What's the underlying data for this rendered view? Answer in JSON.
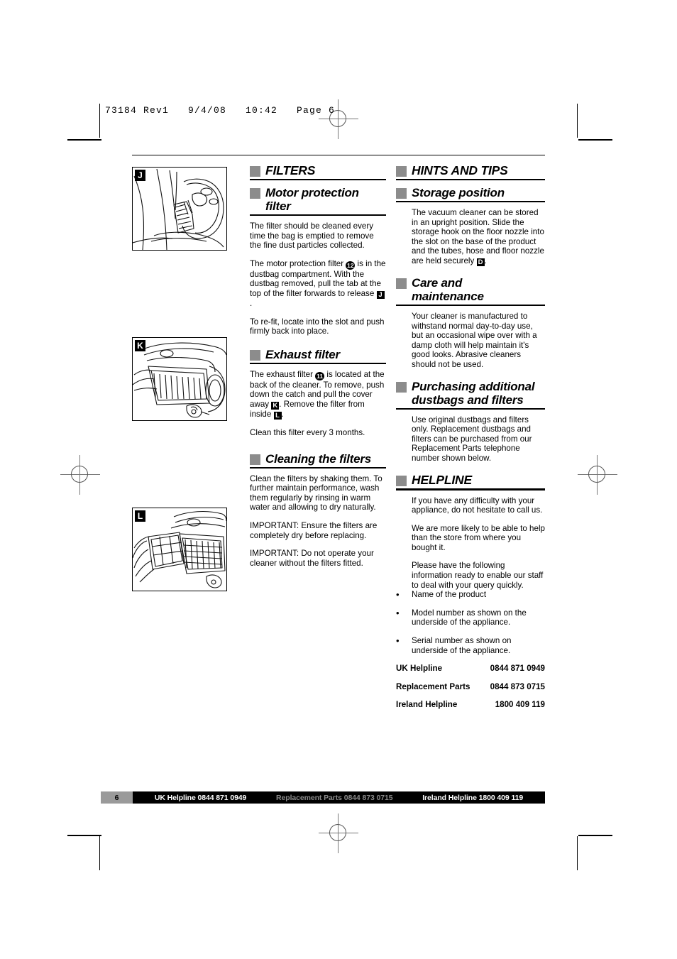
{
  "prepress": {
    "header_line": "73184 Rev1   9/4/08   10:42   Page 6"
  },
  "left_column": {
    "figures": [
      {
        "label": "J",
        "name": "motor-protection-filter-diagram"
      },
      {
        "label": "K",
        "name": "exhaust-filter-cover-diagram"
      },
      {
        "label": "L",
        "name": "exhaust-filter-removal-diagram"
      }
    ],
    "sections": [
      {
        "heading": "FILTERS",
        "paragraphs": []
      },
      {
        "heading": "Motor protection filter",
        "paragraphs": [
          "The filter should be cleaned every time the bag is emptied to remove the fine dust particles collected.",
          "The motor protection filter [12] is in the dustbag compartment. With the dustbag removed, pull the tab at the top of the filter forwards to release [J].",
          "To re-fit, locate into the slot and push firmly back into place."
        ]
      },
      {
        "heading": "Exhaust filter",
        "paragraphs": [
          "The exhaust filter [11] is located at the back of the cleaner. To remove, push down the catch and pull the cover away [K]. Remove the filter from inside [L].",
          "Clean this filter every 3 months."
        ]
      },
      {
        "heading": "Cleaning the filters",
        "paragraphs": [
          "Clean the filters by shaking them. To further maintain performance, wash them regularly by rinsing in warm water and allowing to dry naturally.",
          "IMPORTANT: Ensure the filters are completely dry before replacing.",
          "IMPORTANT: Do not operate your cleaner without the filters fitted."
        ]
      }
    ],
    "text": {
      "motor_p1": "The filter should be cleaned every time the bag is emptied to remove the fine dust particles collected.",
      "motor_p2_a": "The motor protection filter ",
      "motor_p2_badge1": "12",
      "motor_p2_b": " is in the dustbag compartment. With the dustbag removed, pull the tab at the top of the filter forwards to release ",
      "motor_p2_badge2": "J",
      "motor_p2_c": ".",
      "motor_p3": "To re-fit, locate into the slot and push firmly back into place.",
      "exhaust_p1_a": "The exhaust filter ",
      "exhaust_p1_badge1": "11",
      "exhaust_p1_b": " is located at the back of the cleaner. To remove, push down the catch and pull the cover away ",
      "exhaust_p1_badge2": "K",
      "exhaust_p1_c": ". Remove the filter from inside ",
      "exhaust_p1_badge3": "L",
      "exhaust_p1_d": ".",
      "exhaust_p2": "Clean this filter every 3 months.",
      "clean_p1": "Clean the filters by shaking them. To further maintain performance, wash them regularly by rinsing in warm water and allowing to dry naturally.",
      "clean_p2": "IMPORTANT: Ensure the filters are completely dry before replacing.",
      "clean_p3": "IMPORTANT: Do not operate your cleaner without the filters fitted."
    },
    "headings": {
      "filters": "FILTERS",
      "motor_protection_filter": "Motor protection filter",
      "exhaust_filter": "Exhaust filter",
      "cleaning_the_filters": "Cleaning the filters"
    }
  },
  "right_column": {
    "headings": {
      "hints_and_tips": "HINTS AND TIPS",
      "storage_position": "Storage position",
      "care_line1": "Care and",
      "care_line2": "maintenance",
      "purchasing_line1": "Purchasing additional",
      "purchasing_line2": "dustbags and filters",
      "helpline": "HELPLINE"
    },
    "text": {
      "storage_a": "The vacuum cleaner can be stored in an upright position. Slide the storage hook on the floor nozzle into the slot on the base of the product and the tubes, hose and floor nozzle are held securely ",
      "storage_badge": "D",
      "storage_b": ".",
      "care_p1": "Your cleaner is manufactured to withstand normal day-to-day use, but an occasional wipe over with a damp cloth will help maintain it's good looks. Abrasive cleaners should not be used.",
      "purchasing_p1": "Use original dustbags and filters only. Replacement dustbags and filters can be purchased from our Replacement Parts telephone number shown below.",
      "helpline_p1": "If you have any difficulty with your appliance, do not hesitate to call us.",
      "helpline_p2": "We are more likely to be able to help than the store from where you bought it.",
      "helpline_p3": "Please have the following information ready to enable our staff to deal with your query quickly."
    },
    "bullets": [
      "Name of the product",
      "Model number as shown on the underside of the appliance.",
      "Serial number as shown on underside of the appliance."
    ],
    "bullet_glyph": "•",
    "contacts": [
      {
        "label": "UK Helpline",
        "number": "0844 871 0949"
      },
      {
        "label": "Replacement Parts",
        "number": "0844 873 0715"
      },
      {
        "label": "Ireland Helpline",
        "number": "1800 409 119"
      }
    ]
  },
  "footer": {
    "page_number": "6",
    "items": [
      "UK Helpline 0844 871 0949",
      "Replacement Parts 0844 873 0715",
      "Ireland Helpline 1800 409 119"
    ]
  },
  "colors": {
    "heading_bullet": "#8c8c8c",
    "footer_bar": "#000000",
    "footer_pagebox": "#9a9a9a",
    "footer_dim_text": "#8a8a8a"
  }
}
